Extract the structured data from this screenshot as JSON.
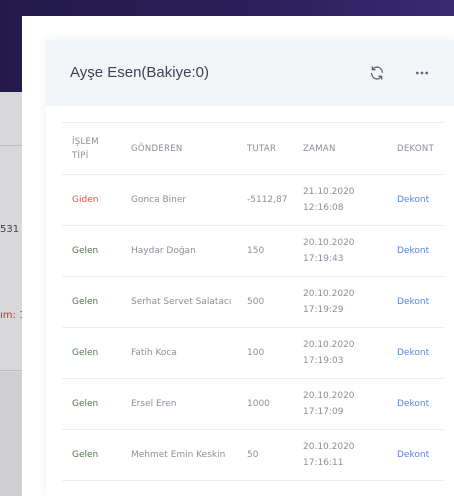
{
  "background": {
    "text_fragment_1": "531",
    "text_fragment_2": "ım: 1"
  },
  "modal": {
    "title": "Ayşe Esen(Bakiye:0)",
    "refresh_icon": "refresh-icon",
    "more_icon": "more-horizontal-icon"
  },
  "table": {
    "headers": {
      "type_line1": "İŞLEM",
      "type_line2": "TİPİ",
      "sender": "GÖNDEREN",
      "amount": "TUTAR",
      "time": "ZAMAN",
      "receipt": "DEKONT"
    },
    "rows": [
      {
        "type": "Giden",
        "sender": "Gonca Biner",
        "amount": "-5112,87",
        "date": "21.10.2020",
        "time": "12:16:08",
        "receipt": "Dekont"
      },
      {
        "type": "Gelen",
        "sender": "Haydar Doğan",
        "amount": "150",
        "date": "20.10.2020",
        "time": "17:19:43",
        "receipt": "Dekont"
      },
      {
        "type": "Gelen",
        "sender": "Serhat Servet Salatacı",
        "amount": "500",
        "date": "20.10.2020",
        "time": "17:19:29",
        "receipt": "Dekont"
      },
      {
        "type": "Gelen",
        "sender": "Fatih Koca",
        "amount": "100",
        "date": "20.10.2020",
        "time": "17:19:03",
        "receipt": "Dekont"
      },
      {
        "type": "Gelen",
        "sender": "Ersel Eren",
        "amount": "1000",
        "date": "20.10.2020",
        "time": "17:17:09",
        "receipt": "Dekont"
      },
      {
        "type": "Gelen",
        "sender": "Mehmet Emin Keskin",
        "amount": "50",
        "date": "20.10.2020",
        "time": "17:16:11",
        "receipt": "Dekont"
      }
    ]
  },
  "colors": {
    "outgoing": "#e0514a",
    "incoming": "#4b7a4b",
    "link": "#5b86d9",
    "topbar": "#2c1f5c"
  }
}
